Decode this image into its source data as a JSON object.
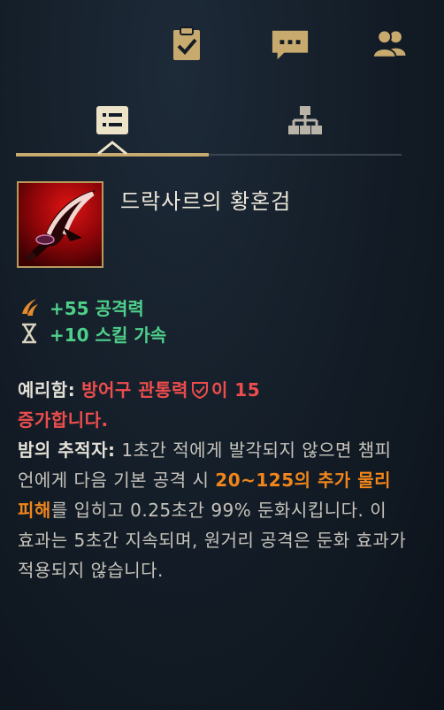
{
  "colors": {
    "gold": "#c8aa6e",
    "stat_green": "#4ed08a",
    "red_text": "#ef4d4d",
    "orange_text": "#f0861c",
    "body_text": "#c6c3bb",
    "background": "#131c26"
  },
  "top_icons": [
    "clipboard-check-icon",
    "chat-bubble-icon",
    "people-icon"
  ],
  "tabs": [
    {
      "icon": "list-icon",
      "active": true
    },
    {
      "icon": "hierarchy-icon",
      "active": false
    }
  ],
  "item": {
    "name": "드락사르의 황혼검",
    "icon": "red-scythe-blade-icon"
  },
  "stats": [
    {
      "icon": "claw-icon",
      "text": "+55 공격력"
    },
    {
      "icon": "hourglass-icon",
      "text": "+10 스킬 가속"
    }
  ],
  "passives": {
    "p1_name": "예리함:",
    "p1_text_a": "방어구 관통력",
    "p1_text_b": "이 15",
    "p1_text_c": "증가합니다.",
    "p2_name": "밤의 추적자:",
    "p2_text_a": "1초간 적에게 발각되지 않으면 챔피언에게 다음 기본 공격 시",
    "p2_damage": "20~125의 추가 물리 피해",
    "p2_text_b": "를 입히고 0.25초간 99% 둔화시킵니다. 이 효과는 5초간 지속되며, 원거리 공격은 둔화 효과가 적용되지 않습니다."
  }
}
